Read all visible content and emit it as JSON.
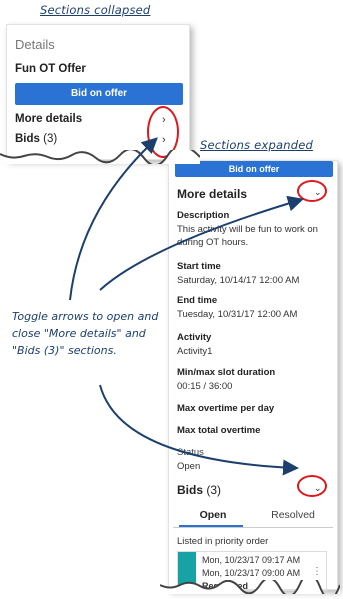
{
  "captions": {
    "collapsed": "Sections collapsed",
    "expanded": "Sections expanded"
  },
  "collapsed_panel": {
    "title": "Details",
    "offer_name": "Fun OT Offer",
    "bid_button": "Bid on offer",
    "more_details": "More details",
    "bids_label": "Bids",
    "bids_count": "(3)"
  },
  "expanded_panel": {
    "bid_button": "Bid on offer",
    "more_details": "More details",
    "fields": [
      {
        "label": "Description",
        "value": "This activity will be fun to work on during OT hours."
      },
      {
        "label": "Start time",
        "value": "Saturday, 10/14/17 12:00 AM"
      },
      {
        "label": "End time",
        "value": "Tuesday, 10/31/17 12:00 AM"
      },
      {
        "label": "Activity",
        "value": "Activity1"
      },
      {
        "label": "Min/max slot duration",
        "value": "00:15 / 36:00"
      },
      {
        "label": "Max overtime per day",
        "value": ""
      },
      {
        "label": "Max total overtime",
        "value": ""
      },
      {
        "label": "Status",
        "value": "Open"
      }
    ],
    "bids_label": "Bids",
    "bids_count": "(3)",
    "tabs": [
      "Open",
      "Resolved"
    ],
    "priority_note": "Listed in priority order",
    "bid_card": {
      "line1": "Mon, 10/23/17 09:17 AM",
      "line2": "Mon, 10/23/17 09:00 AM",
      "line3": "Requested"
    }
  },
  "instruction": "Toggle arrows to open and close \"More details\" and \"Bids (3)\" sections.",
  "colors": {
    "button_blue": "#2a72d3",
    "highlight_red": "#e0171c",
    "annotation_navy": "#1c3f6e",
    "bid_teal": "#17a2a5"
  },
  "icons": {
    "collapsed_toggle": "chevron-right-icon",
    "expanded_toggle": "chevron-down-icon",
    "card_menu": "kebab-menu-icon"
  }
}
